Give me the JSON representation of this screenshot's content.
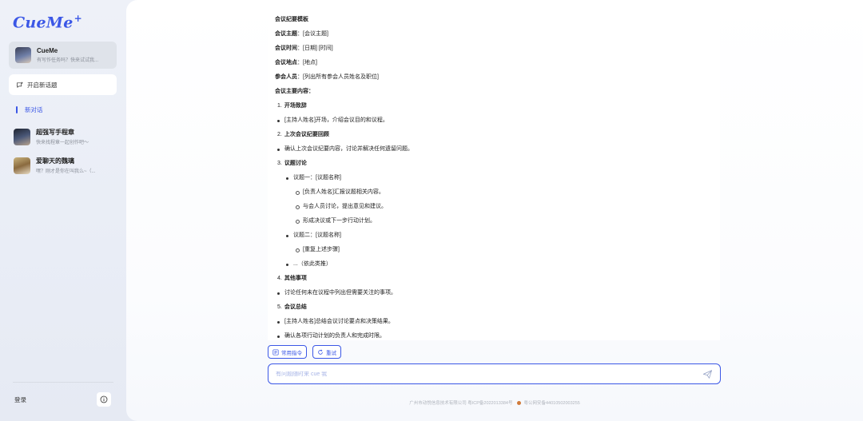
{
  "sidebar": {
    "logo": "CueMe",
    "logo_mark": "+",
    "agent": {
      "name": "CueMe",
      "subtitle": "有写作任务吗？快来试试我..."
    },
    "new_topic_label": "开启新话题",
    "new_chat_label": "新对话",
    "conversations": [
      {
        "title": "超强写手程章",
        "subtitle": "快来找程章一起创作吧～",
        "avatar": "avatar-code"
      },
      {
        "title": "爱聊天的魏璃",
        "subtitle": "嘿？刚才是你在叫我么~（...",
        "avatar": "avatar-chat"
      }
    ],
    "login_label": "登录"
  },
  "message": {
    "lines": [
      {
        "kind": "b",
        "text": "会议纪要模板"
      },
      {
        "kind": "kv",
        "key": "会议主题",
        "value": "：[会议主题]"
      },
      {
        "kind": "kv",
        "key": "会议时间",
        "value": "：[日期] [时间]"
      },
      {
        "kind": "kv",
        "key": "会议地点",
        "value": "：[地点]"
      },
      {
        "kind": "kv",
        "key": "参会人员",
        "value": "：[列出所有参会人员姓名及职位]"
      },
      {
        "kind": "b",
        "text": "会议主要内容："
      },
      {
        "kind": "num",
        "n": "1.",
        "text": "开场致辞"
      },
      {
        "kind": "bul",
        "text": "[主持人姓名]开场，介绍会议目的和议程。"
      },
      {
        "kind": "num",
        "n": "2.",
        "text": "上次会议纪要回顾"
      },
      {
        "kind": "bul",
        "text": "确认上次会议纪要内容，讨论并解决任何遗留问题。"
      },
      {
        "kind": "num",
        "n": "3.",
        "text": "议题讨论"
      },
      {
        "kind": "bul2",
        "text": "议题一：[议题名称]"
      },
      {
        "kind": "bul3",
        "text": "[负责人姓名]汇报议题相关内容。"
      },
      {
        "kind": "bul3",
        "text": "与会人员讨论，提出意见和建议。"
      },
      {
        "kind": "bul3",
        "text": "形成决议或下一步行动计划。"
      },
      {
        "kind": "bul2",
        "text": "议题二：[议题名称]"
      },
      {
        "kind": "bul3",
        "text": "[重复上述步骤]"
      },
      {
        "kind": "bul2",
        "text": "...（依此类推）"
      },
      {
        "kind": "num",
        "n": "4.",
        "text": "其他事项"
      },
      {
        "kind": "bul",
        "text": "讨论任何未在议程中列出但需要关注的事项。"
      },
      {
        "kind": "num",
        "n": "5.",
        "text": "会议总结"
      },
      {
        "kind": "bul",
        "text": "[主持人姓名]总结会议讨论要点和决策结果。"
      },
      {
        "kind": "bul",
        "text": "确认各项行动计划的负责人和完成时限。"
      }
    ]
  },
  "actions": {
    "common_commands_label": "常用指令",
    "retry_label": "重试"
  },
  "input": {
    "placeholder": "有问题随时来 cue 我"
  },
  "footer": {
    "company": "广州市动悦信息技术有限公司 粤ICP备2022013384号",
    "police": "粤公网安备44010502003255"
  },
  "colors": {
    "accent": "#3b57e6",
    "sidebar_bg": "#eef1f8",
    "card_active": "#dfe3ea"
  },
  "icons": {
    "new_topic": "chat-plus-icon",
    "common_commands": "command-icon",
    "retry": "refresh-icon",
    "send": "send-icon",
    "info": "info-icon"
  }
}
